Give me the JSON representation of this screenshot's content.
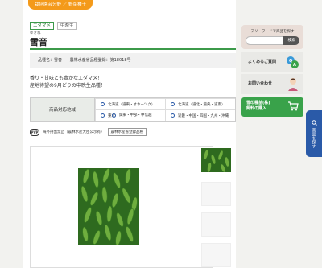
{
  "breadcrumb": {
    "label": "栽培園芸分野 ／ 野菜種子"
  },
  "product": {
    "tags": [
      "エダマメ",
      "中晩生"
    ],
    "ruby": "ゆきね",
    "name": "雪音",
    "meta_name": "品種名：雪音",
    "meta_reg": "農林水産省品種登録：第18018号",
    "catch_1": "香り・甘味とも豊かなエダマメ！",
    "catch_2": "産地待望の9月どりの中晩生品種！"
  },
  "area": {
    "label": "商品対応地域",
    "items": [
      "北海道（道東・オホーツク）",
      "北海道（道北・道央・道南）",
      "東北",
      "近畿・中国・四国・九州・沖縄",
      "関東・中部・甲信越"
    ]
  },
  "pvp": {
    "icon": "PVP",
    "text": "海外持出禁止（農林水産大臣公示有）",
    "button": "農林水産省登録品種"
  },
  "sidebar": {
    "search_title": "フリーワードで商品を探す",
    "search_placeholder": "",
    "search_button": "検索",
    "faq": "よくあるご質問",
    "contact": "お問い合わせ",
    "cart_line1": "雪印種苗(株)",
    "cart_line2": "飼料の購入"
  },
  "floating": {
    "label": "商品を探す",
    "icon": "search-icon"
  },
  "colors": {
    "accent_green": "#39a24a",
    "breadcrumb_orange": "#f49a1a",
    "float_blue": "#2a5aa8"
  }
}
